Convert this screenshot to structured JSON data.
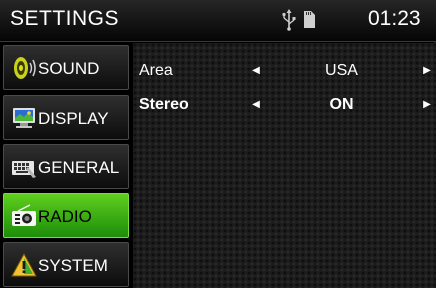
{
  "header": {
    "title": "SETTINGS",
    "time": "01:23",
    "icons": [
      "usb-icon",
      "sd-card-icon"
    ]
  },
  "sidebar": {
    "items": [
      {
        "label": "SOUND",
        "icon": "speaker-icon",
        "active": false
      },
      {
        "label": "DISPLAY",
        "icon": "monitor-icon",
        "active": false
      },
      {
        "label": "GENERAL",
        "icon": "keyboard-icon",
        "active": false
      },
      {
        "label": "RADIO",
        "icon": "radio-icon",
        "active": true
      },
      {
        "label": "SYSTEM",
        "icon": "warning-icon",
        "active": false
      }
    ]
  },
  "settings": {
    "rows": [
      {
        "label": "Area",
        "value": "USA"
      },
      {
        "label": "Stereo",
        "value": "ON"
      }
    ]
  },
  "colors": {
    "active_green": "#3fb314",
    "background": "#000000"
  }
}
